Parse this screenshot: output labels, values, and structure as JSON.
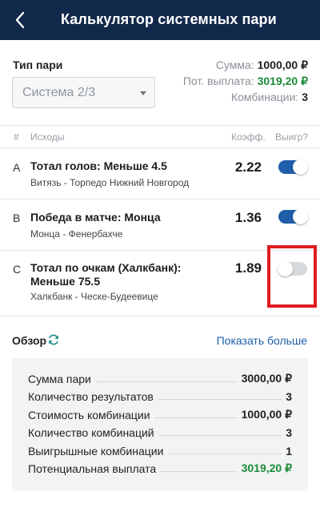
{
  "header": {
    "title": "Калькулятор системных пари"
  },
  "bet_type": {
    "label": "Тип пари",
    "selected": "Система 2/3"
  },
  "totals": {
    "sum_label": "Сумма:",
    "sum_value": "1000,00 ₽",
    "payout_label": "Пот. выплата:",
    "payout_value": "3019,20 ₽",
    "combos_label": "Комбинации:",
    "combos_value": "3"
  },
  "table_headers": {
    "num": "#",
    "outcomes": "Исходы",
    "coef": "Коэфф.",
    "win": "Выигр?"
  },
  "outcomes": [
    {
      "letter": "A",
      "title": "Тотал голов: Меньше 4.5",
      "match": "Витязь - Торпедо Нижний Новгород",
      "coef": "2.22",
      "win": true
    },
    {
      "letter": "B",
      "title": "Победа в матче: Монца",
      "match": "Монца - Фенербахче",
      "coef": "1.36",
      "win": true
    },
    {
      "letter": "C",
      "title_line1": "Тотал по очкам (Халкбанк):",
      "title_line2": "Меньше 75.5",
      "match": "Халкбанк - Ческе-Будеевице",
      "coef": "1.89",
      "win": false
    }
  ],
  "overview": {
    "label": "Обзор",
    "show_more": "Показать больше",
    "rows": [
      {
        "key": "Сумма пари",
        "value": "3000,00 ₽"
      },
      {
        "key": "Количество результатов",
        "value": "3"
      },
      {
        "key": "Стоимость комбинации",
        "value": "1000,00 ₽"
      },
      {
        "key": "Количество комбинаций",
        "value": "3"
      },
      {
        "key": "Выигрышные комбинации",
        "value": "1"
      },
      {
        "key": "Потенциальная выплата",
        "value": "3019,20 ₽"
      }
    ]
  },
  "colors": {
    "header_bg": "#13294b",
    "accent_blue": "#1f5ea8",
    "green": "#1a8c3a",
    "highlight_red": "#e01b24"
  }
}
